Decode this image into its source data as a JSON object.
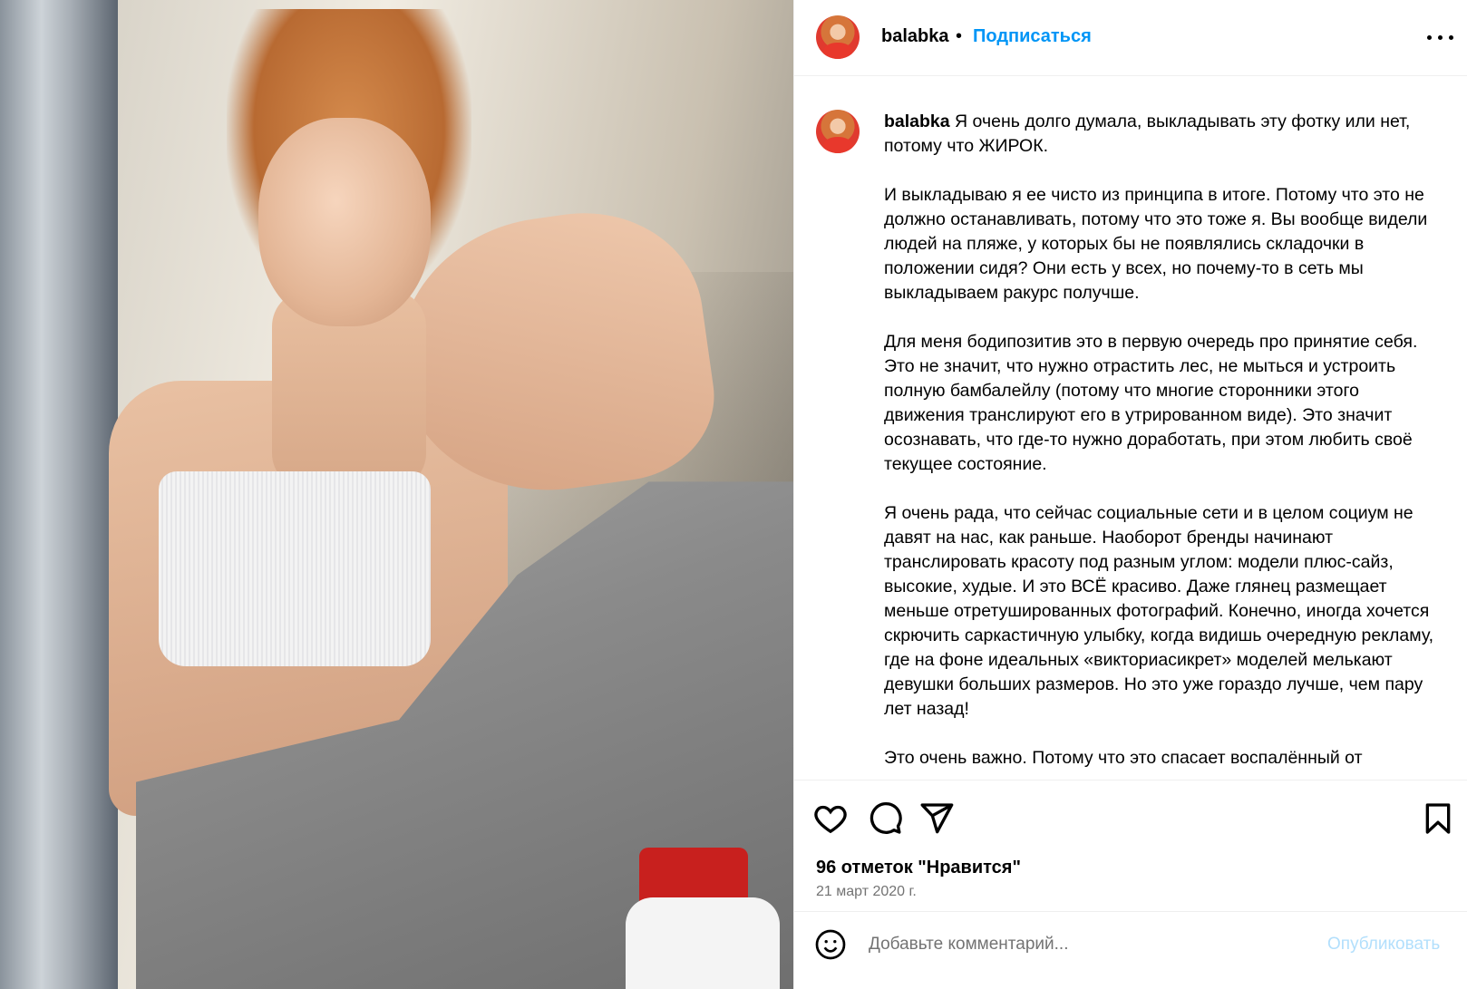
{
  "header": {
    "username": "balabka",
    "separator": "•",
    "follow_label": "Подписаться"
  },
  "caption": {
    "username": "balabka",
    "paragraphs": [
      "Я очень долго думала, выкладывать эту фотку или нет, потому что ЖИРОК.",
      "И выкладываю я ее чисто из принципа в итоге. Потому что это не должно останавливать, потому что это тоже я. Вы вообще видели людей на пляже, у которых бы не появлялись складочки в положении сидя? Они есть у всех, но почему-то в сеть мы выкладываем ракурс получше.",
      "Для меня бодипозитив это в первую очередь про принятие себя. Это не значит, что нужно отрастить лес, не мыться и устроить полную бамбалейлу (потому что многие сторонники этого движения транслируют его в утрированном виде). Это значит осознавать, что где-то нужно доработать, при этом любить своё текущее состояние.",
      "Я очень рада, что сейчас социальные сети и в целом социум не давят на нас, как раньше. Наоборот бренды начинают транслировать красоту под разным углом: модели плюс-сайз, высокие, худые. И это ВСЁ красиво. Даже глянец размещает меньше отретушированных фотографий. Конечно, иногда хочется скрючить саркастичную улыбку, когда видишь очередную рекламу, где на фоне идеальных «викториасикрет» моделей мелькают девушки больших размеров. Но это уже гораздо лучше, чем пару лет назад!",
      "Это очень важно. Потому что это спасает воспалённый от"
    ]
  },
  "actions": {
    "icons": [
      "heart-icon",
      "comment-icon",
      "share-icon",
      "bookmark-icon"
    ],
    "likes_text": "96 отметок \"Нравится\"",
    "date": "21 март 2020 г."
  },
  "comment_bar": {
    "placeholder": "Добавьте комментарий...",
    "publish_label": "Опубликовать"
  },
  "colors": {
    "accent": "#0095f6",
    "muted": "#737373",
    "publish_disabled": "#b2dffc"
  }
}
